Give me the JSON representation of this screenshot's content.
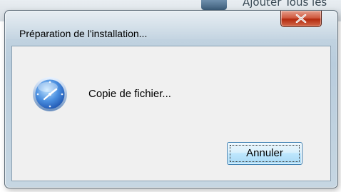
{
  "background": {
    "title_fragment": "Ajouter Tous les"
  },
  "dialog": {
    "title": "Préparation de l'installation...",
    "close_icon": "close-icon",
    "status_icon": "clock-icon",
    "status_text": "Copie de fichier...",
    "cancel_label": "Annuler"
  },
  "colors": {
    "close_button": "#c9452a",
    "button_border": "#3c7fb1",
    "client_background": "#f0f0f0"
  }
}
